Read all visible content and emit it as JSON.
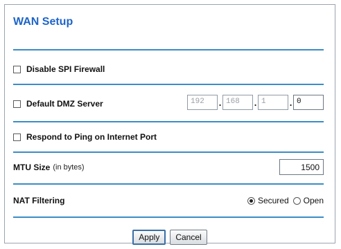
{
  "page": {
    "title": "WAN Setup"
  },
  "spi_firewall": {
    "label": "Disable SPI Firewall",
    "checked": false
  },
  "dmz": {
    "label": "Default DMZ Server",
    "checked": false,
    "octets": [
      "192",
      "168",
      "1",
      "0"
    ]
  },
  "ping": {
    "label": "Respond to Ping on Internet Port",
    "checked": false
  },
  "mtu": {
    "label": "MTU Size",
    "unit_note": "(in bytes)",
    "value": "1500"
  },
  "nat": {
    "label": "NAT Filtering",
    "options": [
      "Secured",
      "Open"
    ],
    "selected": "Secured"
  },
  "buttons": {
    "apply": "Apply",
    "cancel": "Cancel"
  },
  "colors": {
    "accent": "#1e64c8",
    "rule": "#3a8cc6"
  }
}
